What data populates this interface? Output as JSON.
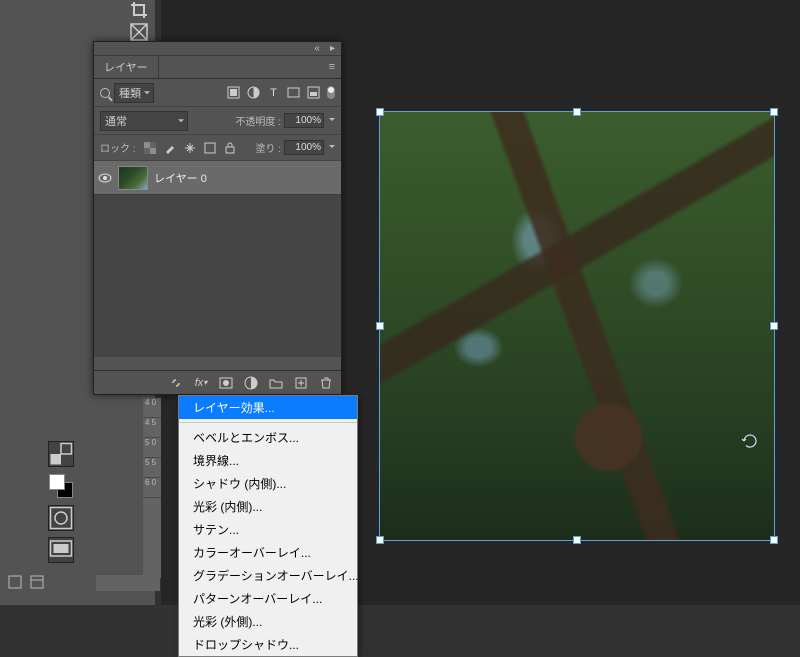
{
  "panel": {
    "title": "レイヤー",
    "collapse_icon": "«",
    "close_icon": "▸▸",
    "filter": {
      "kind_label": "種類"
    },
    "blend": {
      "mode": "通常",
      "opacity_label": "不透明度 :",
      "opacity_value": "100%"
    },
    "lock": {
      "label": "ロック :",
      "fill_label": "塗り :",
      "fill_value": "100%"
    },
    "layers": [
      {
        "name": "レイヤー 0"
      }
    ],
    "footer_icons": [
      "link",
      "fx",
      "mask",
      "adjust",
      "group",
      "new",
      "trash"
    ]
  },
  "fx_menu": {
    "items": [
      "レイヤー効果...",
      "ベベルとエンボス...",
      "境界線...",
      "シャドウ (内側)...",
      "光彩 (内側)...",
      "サテン...",
      "カラーオーバーレイ...",
      "グラデーションオーバーレイ...",
      "パターンオーバーレイ...",
      "光彩 (外側)...",
      "ドロップシャドウ..."
    ],
    "highlighted_index": 0
  },
  "ruler_marks": [
    "4 0",
    "4 5",
    "5 0",
    "5 5",
    "6 0"
  ],
  "zoom_indicator": ""
}
